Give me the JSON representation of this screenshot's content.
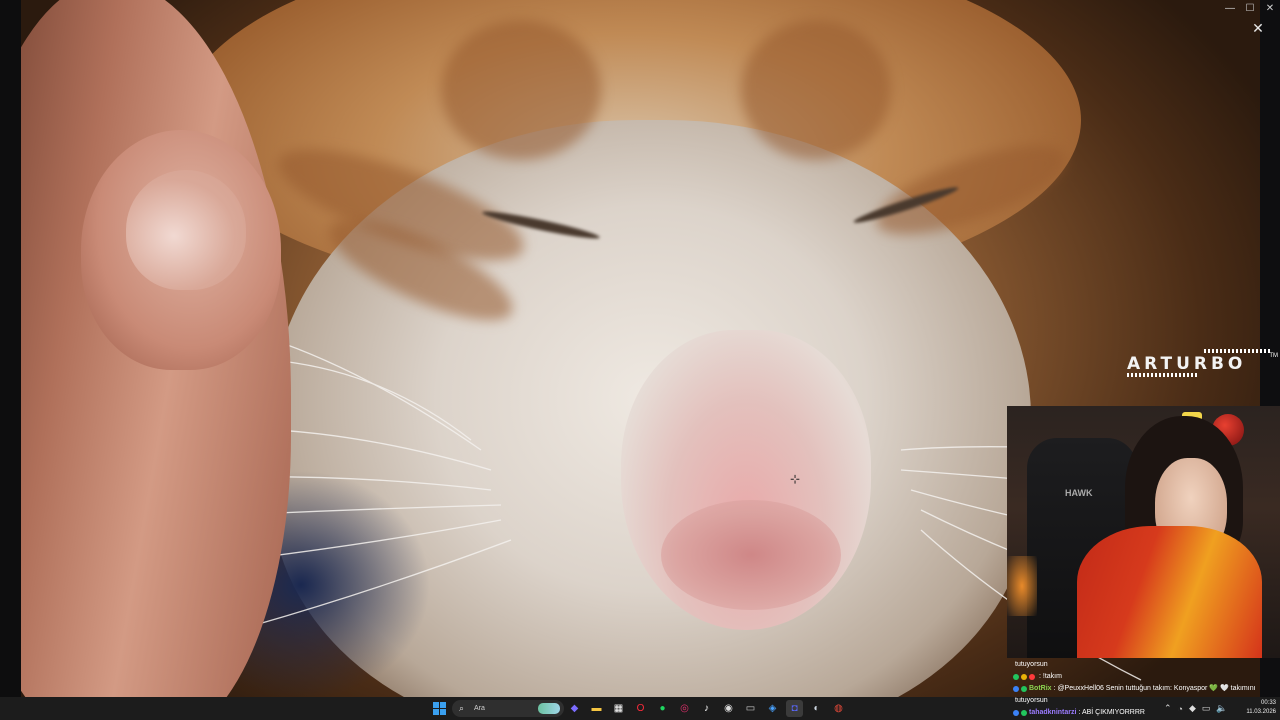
{
  "window": {
    "minimize_icon": "minimize-icon",
    "maximize_icon": "maximize-icon",
    "close_icon": "close-icon",
    "minimize_glyph": "—",
    "maximize_glyph": "☐",
    "close_glyph": "✕",
    "viewer_close_glyph": "✕"
  },
  "overlay": {
    "logo_text": "ARTURBO",
    "logo_tm": "TM",
    "webcam_chair_brand": "HAWK"
  },
  "chat": [
    {
      "user": "",
      "text": "tutuyorsun",
      "user_color": "#ffffff",
      "badges": []
    },
    {
      "user": "",
      "text": ": !takım",
      "user_color": "#ff3b3b",
      "badges": [
        "#22c55e",
        "#eab308",
        "#ff3b3b"
      ]
    },
    {
      "user": "BotRix",
      "text": ": @PeuxxHell06 Senin tuttuğun takım: Konyaspor 💚 🤍 takımını",
      "user_color": "#8bd450",
      "badges": [
        "#3b82f6",
        "#22c55e"
      ]
    },
    {
      "user": "",
      "text": "tutuyorsun",
      "user_color": "#ffffff",
      "badges": []
    },
    {
      "user": "tahadknintarzi",
      "text": ": ABİ ÇIKMIYORRRR",
      "user_color": "#9b7bff",
      "badges": [
        "#3b82f6",
        "#22c55e"
      ]
    }
  ],
  "taskbar": {
    "search_placeholder": "Ara",
    "search_icon": "search-icon",
    "apps": [
      {
        "name": "copilot-icon",
        "glyph": "◆",
        "color": "#7b6cff"
      },
      {
        "name": "file-explorer-icon",
        "glyph": "▬",
        "color": "#f5c542"
      },
      {
        "name": "store-icon",
        "glyph": "▦",
        "color": "#ffffff"
      },
      {
        "name": "opera-icon",
        "glyph": "O",
        "color": "#ff2b3b"
      },
      {
        "name": "spotify-icon",
        "glyph": "●",
        "color": "#1ed760"
      },
      {
        "name": "instagram-icon",
        "glyph": "◎",
        "color": "#e1306c"
      },
      {
        "name": "tiktok-icon",
        "glyph": "♪",
        "color": "#ffffff"
      },
      {
        "name": "obs-icon",
        "glyph": "◉",
        "color": "#dddddd"
      },
      {
        "name": "keyboard-icon",
        "glyph": "▭",
        "color": "#cccccc"
      },
      {
        "name": "app-icon",
        "glyph": "◈",
        "color": "#4aa3ff"
      },
      {
        "name": "discord-icon",
        "glyph": "◘",
        "color": "#5865f2"
      },
      {
        "name": "steam-icon",
        "glyph": "◐",
        "color": "#cfd8e3"
      },
      {
        "name": "chrome-icon",
        "glyph": "◍",
        "color": "#e84a3a"
      }
    ],
    "tray_icons": [
      "chevron-up-icon",
      "app-tray-icon",
      "shield-tray-icon",
      "network-icon",
      "volume-icon"
    ],
    "tray_glyphs": [
      "⌃",
      "◔",
      "◆",
      "▭",
      "🔈"
    ],
    "time": "00:33",
    "date": "11.03.2026"
  }
}
